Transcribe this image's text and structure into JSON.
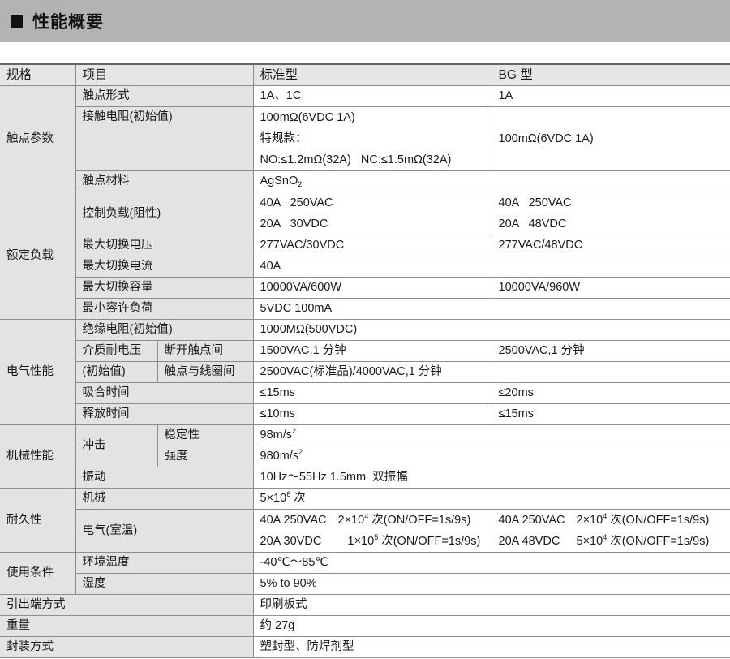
{
  "section_title": "性能概要",
  "headers": {
    "spec": "规格",
    "item": "项目",
    "standard": "标准型",
    "bg": "BG 型"
  },
  "contact_params": {
    "group": "触点参数",
    "form": {
      "label": "触点形式",
      "std": "1A、1C",
      "bg": "1A"
    },
    "resistance": {
      "label": "接触电阻(初始值)",
      "std_line1": "100mΩ(6VDC 1A)",
      "std_line2": "特规款：",
      "std_line3": "NO:≤1.2mΩ(32A)   NC:≤1.5mΩ(32A)",
      "bg": "100mΩ(6VDC 1A)"
    },
    "material": {
      "label": "触点材料",
      "value": "AgSnO",
      "sub": "2"
    }
  },
  "rated_load": {
    "group": "额定负载",
    "control_load": {
      "label": "控制负载(阻性)",
      "std_line1": "40A   250VAC",
      "std_line2": "20A   30VDC",
      "bg_line1": "40A   250VAC",
      "bg_line2": "20A   48VDC"
    },
    "max_voltage": {
      "label": "最大切换电压",
      "std": "277VAC/30VDC",
      "bg": "277VAC/48VDC"
    },
    "max_current": {
      "label": "最大切换电流",
      "value": "40A"
    },
    "max_capacity": {
      "label": "最大切换容量",
      "std": "10000VA/600W",
      "bg": "10000VA/960W"
    },
    "min_load": {
      "label": "最小容许负荷",
      "value": "5VDC 100mA"
    }
  },
  "electrical": {
    "group": "电气性能",
    "insulation": {
      "label": "绝缘电阻(初始值)",
      "value": "1000MΩ(500VDC)"
    },
    "dielectric_label_1": "介质耐电压",
    "dielectric_label_2": "(初始值)",
    "open_contacts": {
      "label": "断开触点间",
      "std": "1500VAC,1 分钟",
      "bg": "2500VAC,1 分钟"
    },
    "contact_coil": {
      "label": "触点与线圈间",
      "value": "2500VAC(标准品)/4000VAC,1 分钟"
    },
    "operate_time": {
      "label": "吸合时间",
      "std": "≤15ms",
      "bg": "≤20ms"
    },
    "release_time": {
      "label": "释放时间",
      "std": "≤10ms",
      "bg": "≤15ms"
    }
  },
  "mechanical": {
    "group": "机械性能",
    "shock": "冲击",
    "stability": {
      "label": "稳定性",
      "value": "98m/s",
      "exp": "2"
    },
    "strength": {
      "label": "强度",
      "value": "980m/s",
      "exp": "2"
    },
    "vibration": {
      "label": "振动",
      "value": "10Hz～55Hz 1.5mm  双振幅"
    }
  },
  "durability": {
    "group": "耐久性",
    "mechanical": {
      "label": "机械",
      "base": "5×10",
      "exp": "6",
      "unit": " 次"
    },
    "electrical_label": "电气(室温)",
    "std_rows": [
      {
        "load": "40A 250VAC",
        "base": "2×10",
        "exp": "4",
        "rest": " 次(ON/OFF=1s/9s)"
      },
      {
        "load": "20A 30VDC",
        "base": "1×10",
        "exp": "5",
        "rest": " 次(ON/OFF=1s/9s)"
      }
    ],
    "bg_rows": [
      {
        "load": "40A 250VAC",
        "base": "2×10",
        "exp": "4",
        "rest": " 次(ON/OFF=1s/9s)"
      },
      {
        "load": "20A 48VDC",
        "base": "5×10",
        "exp": "4",
        "rest": " 次(ON/OFF=1s/9s)"
      }
    ]
  },
  "usage": {
    "group": "使用条件",
    "temperature": {
      "label": "环境温度",
      "value": "-40℃～85℃"
    },
    "humidity": {
      "label": "湿度",
      "value": "5% to 90%"
    }
  },
  "terminal": {
    "label": "引出端方式",
    "value": "印刷板式"
  },
  "weight": {
    "label": "重量",
    "value": "约 27g"
  },
  "sealing": {
    "label": "封装方式",
    "value": "塑封型、防焊剂型"
  }
}
